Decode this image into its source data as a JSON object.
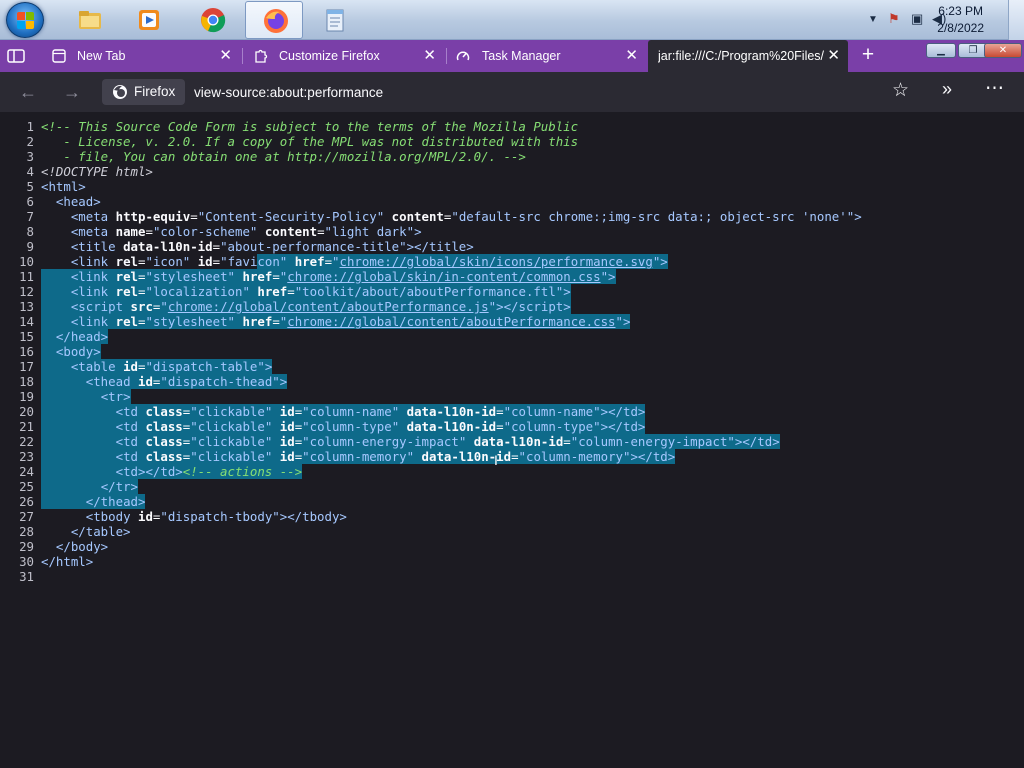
{
  "taskbar": {
    "pinned": [
      {
        "name": "windows-explorer",
        "active": false
      },
      {
        "name": "media-player",
        "active": false
      },
      {
        "name": "chrome",
        "active": false
      },
      {
        "name": "firefox",
        "active": true
      },
      {
        "name": "notepad",
        "active": false
      }
    ],
    "clock_time": "6:23 PM",
    "clock_date": "2/8/2022"
  },
  "tabs": [
    {
      "title": "New Tab",
      "icon": "firefox-tab-icon"
    },
    {
      "title": "Customize Firefox",
      "icon": "puzzle-icon"
    },
    {
      "title": "Task Manager",
      "icon": "gauge-icon"
    },
    {
      "title": "jar:file:///C:/Program%20Files/",
      "icon": "none"
    }
  ],
  "navbar": {
    "identity_label": "Firefox",
    "url": "view-source:about:performance"
  },
  "source_lines": [
    {
      "n": "1"
    },
    {
      "n": "2"
    },
    {
      "n": "3"
    },
    {
      "n": "4"
    },
    {
      "n": "5"
    },
    {
      "n": "6"
    },
    {
      "n": "7"
    },
    {
      "n": "8"
    },
    {
      "n": "9"
    },
    {
      "n": "10"
    },
    {
      "n": "11"
    },
    {
      "n": "12"
    },
    {
      "n": "13"
    },
    {
      "n": "14"
    },
    {
      "n": "15"
    },
    {
      "n": "16"
    },
    {
      "n": "17"
    },
    {
      "n": "18"
    },
    {
      "n": "19"
    },
    {
      "n": "20"
    },
    {
      "n": "21"
    },
    {
      "n": "22"
    },
    {
      "n": "23"
    },
    {
      "n": "24"
    },
    {
      "n": "25"
    },
    {
      "n": "26"
    },
    {
      "n": "27"
    },
    {
      "n": "28"
    },
    {
      "n": "29"
    },
    {
      "n": "30"
    },
    {
      "n": "31"
    }
  ],
  "colors": {
    "tabstrip": "#7a3fa8",
    "toolbar": "#2b2a33",
    "selection": "#0e6a8a",
    "comment": "#86de74",
    "tag": "#a6c8ff"
  }
}
